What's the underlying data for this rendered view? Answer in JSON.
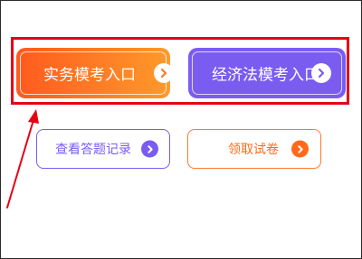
{
  "buttons": {
    "practice_exam": {
      "label": "实务模考入口",
      "icon": "chevron-right-icon",
      "color": "#ff7a1c"
    },
    "economic_law_exam": {
      "label": "经济法模考入口",
      "icon": "chevron-right-icon",
      "color": "#7a5cf0"
    },
    "view_records": {
      "label": "查看答题记录",
      "icon": "chevron-right-icon",
      "color": "#7a5cf0"
    },
    "get_paper": {
      "label": "领取试卷",
      "icon": "chevron-right-icon",
      "color": "#ff6a1a"
    }
  },
  "annotation": {
    "highlight_color": "#e60012"
  }
}
